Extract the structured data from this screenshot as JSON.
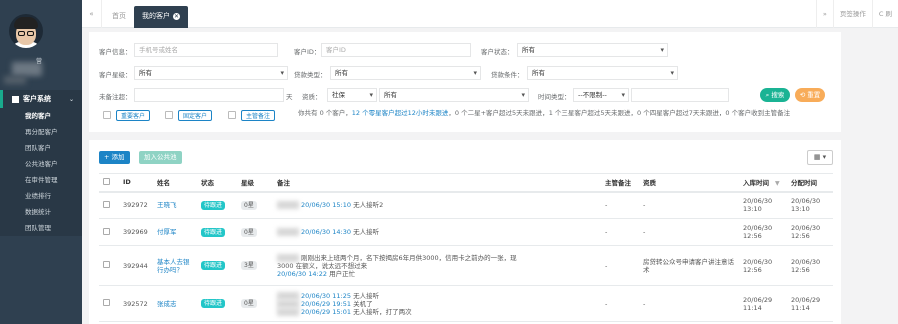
{
  "sidebar": {
    "profile_suffix": "营",
    "menu_title": "客户系统",
    "items": [
      {
        "label": "我的客户",
        "active": true
      },
      {
        "label": "再分配客户",
        "active": false
      },
      {
        "label": "团队客户",
        "active": false
      },
      {
        "label": "公共池客户",
        "active": false
      },
      {
        "label": "在审件管理",
        "active": false
      },
      {
        "label": "业绩排行",
        "active": false
      },
      {
        "label": "数据统计",
        "active": false
      },
      {
        "label": "团队管理",
        "active": false
      }
    ]
  },
  "tabs": {
    "back_icon": "«",
    "home": "首页",
    "active": "我的客户",
    "forward_icon": "»",
    "page_ops": "页签操作",
    "refresh": "C 刷"
  },
  "filter": {
    "customer_info_label": "客户信息：",
    "customer_info_placeholder": "手机号或姓名",
    "customer_id_label": "客户ID：",
    "customer_id_placeholder": "客户ID",
    "status_label": "客户状态：",
    "status_value": "所有",
    "star_label": "客户星级：",
    "star_value": "所有",
    "loan_type_label": "贷款类型：",
    "loan_type_value": "所有",
    "loan_cond_label": "贷款条件：",
    "loan_cond_value": "所有",
    "remark_label": "未备注超：",
    "remark_unit": "天",
    "qual_label": "资质：",
    "qual_type": "社保",
    "qual_value": "所有",
    "time_label": "时间类型：",
    "time_value": "--不限制--",
    "search_btn": "搜索",
    "reset_btn": "重置",
    "checks": [
      "重要客户",
      "固定客户",
      "主管备注"
    ],
    "summary_parts": [
      {
        "text": "你共有 0 个客户，",
        "blue": false
      },
      {
        "text": "12 个零星客户超过12小时未跟进",
        "blue": true
      },
      {
        "text": "，0 个二星+客户超过5天未跟进，",
        "blue": false
      },
      {
        "text": "1 个三星客户超过5天未跟进，",
        "blue": false
      },
      {
        "text": "0 个四星客户超过7天未跟进，",
        "blue": false
      },
      {
        "text": "0 个客户收到主管备注",
        "blue": false
      }
    ]
  },
  "table": {
    "add_btn": "+ 添加",
    "pool_btn": "加入公共池",
    "cols_btn": "▦ ▾",
    "headers": {
      "id": "ID",
      "name": "姓名",
      "status": "状态",
      "star": "星级",
      "remark": "备注",
      "supervisor": "主管备注",
      "qual": "资质",
      "entry_time": "入库时间",
      "assign_time": "分配时间"
    },
    "rows": [
      {
        "id": "392972",
        "name": "王晓飞",
        "status": "待跟进",
        "star": "0星",
        "remarks": [
          {
            "time": "20/06/30 15:10",
            "text": "无人接听2"
          }
        ],
        "supervisor": "-",
        "qual": "-",
        "entry_time": "20/06/30 13:10",
        "assign_time": "20/06/30 13:10"
      },
      {
        "id": "392969",
        "name": "付厚军",
        "status": "待跟进",
        "star": "0星",
        "remarks": [
          {
            "time": "20/06/30 14:30",
            "text": "无人接听"
          }
        ],
        "supervisor": "-",
        "qual": "-",
        "entry_time": "20/06/30 12:56",
        "assign_time": "20/06/30 12:56"
      },
      {
        "id": "392944",
        "name": "基本人去银行办吗？",
        "status": "待跟进",
        "star": "3星",
        "remarks": [
          {
            "time": "",
            "text": "刚刚出来上班两个月，名下按揭房6年月供3000，信用卡之前办的一张，现"
          },
          {
            "time": "",
            "text": "3000 在额义，说太远不想过来"
          },
          {
            "time": "20/06/30 14:22",
            "text": "用户正忙"
          }
        ],
        "supervisor": "-",
        "qual": "房贷转公众号申请客户讲注意话术",
        "entry_time": "20/06/30 12:56",
        "assign_time": "20/06/30 12:56"
      },
      {
        "id": "392572",
        "name": "张成志",
        "status": "待跟进",
        "star": "0星",
        "remarks": [
          {
            "time": "20/06/30 11:25",
            "text": "无人接听"
          },
          {
            "time": "20/06/29 19:51",
            "text": "关机了"
          },
          {
            "time": "20/06/29 15:01",
            "text": "无人接听，打了两次"
          }
        ],
        "supervisor": "-",
        "qual": "-",
        "entry_time": "20/06/29 11:14",
        "assign_time": "20/06/29 11:14"
      }
    ]
  }
}
